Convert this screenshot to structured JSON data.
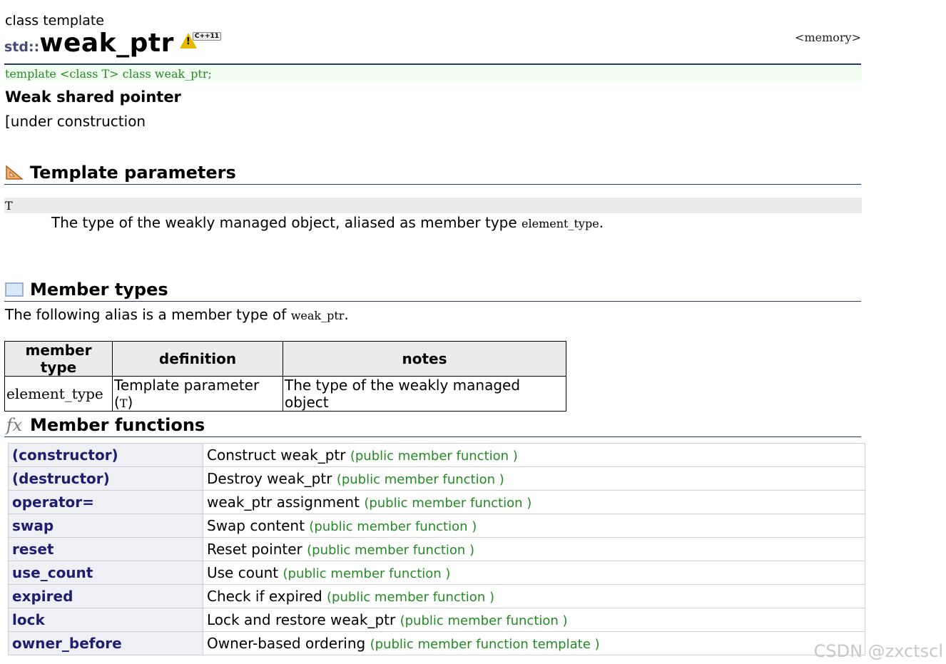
{
  "header": {
    "kind": "class template",
    "namespace": "std::",
    "name": "weak_ptr",
    "std_badge": "C++11",
    "header_ref": "<memory>",
    "declaration": "template <class T> class weak_ptr;",
    "subtitle": "Weak shared pointer",
    "construction_note": "[under construction"
  },
  "template_params": {
    "heading": "Template parameters",
    "param_name": "T",
    "desc_prefix": "The type of the weakly managed object, aliased as member type ",
    "desc_code": "element_type",
    "desc_suffix": "."
  },
  "member_types": {
    "heading": "Member types",
    "intro_prefix": "The following alias is a member type of ",
    "intro_code": "weak_ptr",
    "intro_suffix": ".",
    "columns": [
      "member type",
      "definition",
      "notes"
    ],
    "row": {
      "type": "element_type",
      "def_prefix": "Template parameter (",
      "def_code": "T",
      "def_suffix": ")",
      "notes": "The type of the weakly managed object"
    }
  },
  "member_functions": {
    "heading": "Member functions",
    "rows": [
      {
        "name": "(constructor)",
        "desc": "Construct weak_ptr",
        "kind": "(public member function )"
      },
      {
        "name": "(destructor)",
        "desc": "Destroy weak_ptr",
        "kind": "(public member function )"
      },
      {
        "name": "operator=",
        "desc": "weak_ptr assignment",
        "kind": "(public member function )"
      },
      {
        "name": "swap",
        "desc": "Swap content",
        "kind": "(public member function )"
      },
      {
        "name": "reset",
        "desc": "Reset pointer",
        "kind": "(public member function )"
      },
      {
        "name": "use_count",
        "desc": "Use count",
        "kind": "(public member function )"
      },
      {
        "name": "expired",
        "desc": "Check if expired",
        "kind": "(public member function )"
      },
      {
        "name": "lock",
        "desc": "Lock and restore weak_ptr",
        "kind": "(public member function )"
      },
      {
        "name": "owner_before",
        "desc": "Owner-based ordering",
        "kind": "(public member function template )"
      }
    ]
  },
  "watermark": "CSDN @zxctscl",
  "colors": {
    "link": "#1e1e6e",
    "kind": "#228b22",
    "rule": "#1e3c6e"
  }
}
